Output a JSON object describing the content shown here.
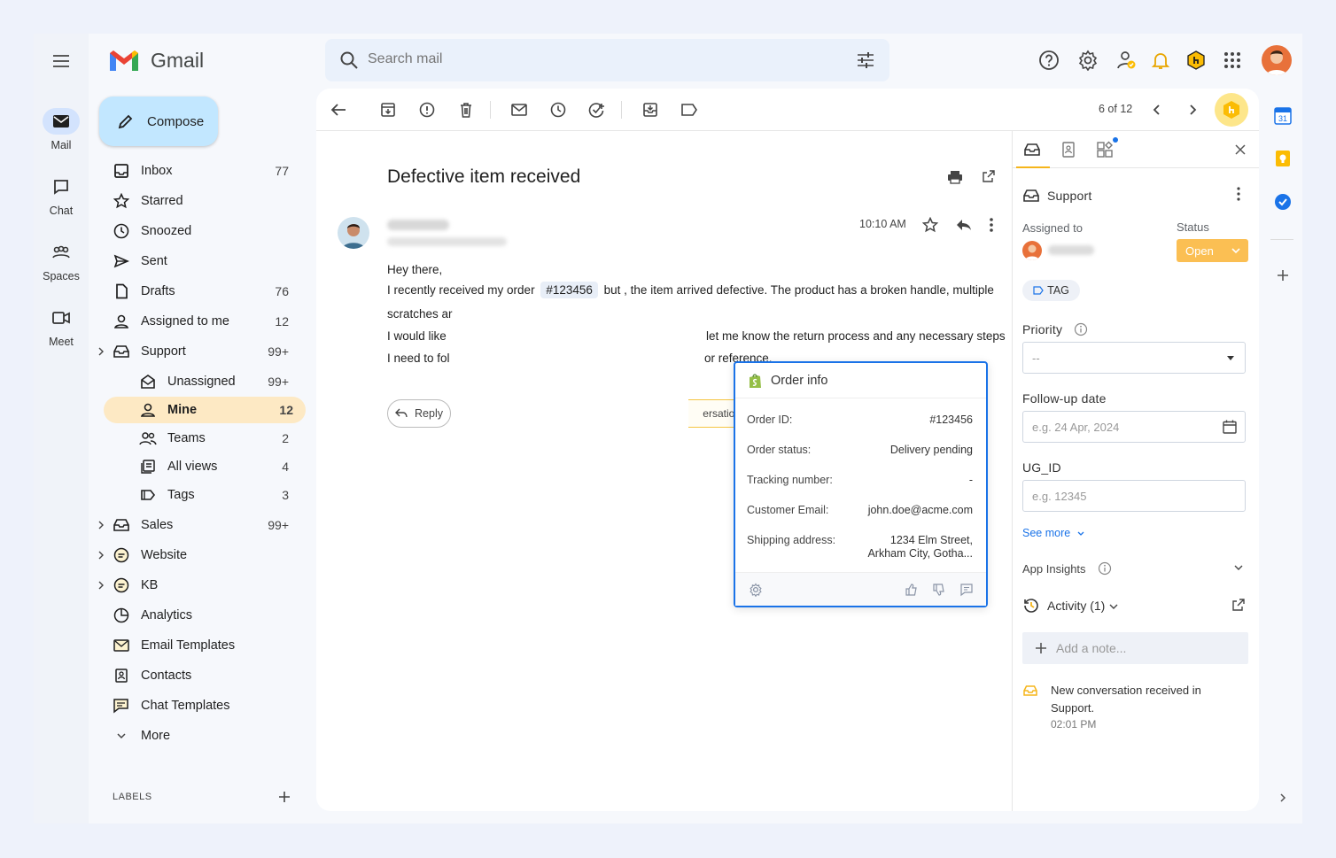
{
  "app": {
    "name": "Gmail"
  },
  "rail": [
    {
      "label": "Mail",
      "icon": "mail-icon",
      "active": true
    },
    {
      "label": "Chat",
      "icon": "chat-icon"
    },
    {
      "label": "Spaces",
      "icon": "spaces-icon"
    },
    {
      "label": "Meet",
      "icon": "meet-icon"
    }
  ],
  "compose": {
    "label": "Compose"
  },
  "nav": [
    {
      "label": "Inbox",
      "count": "77"
    },
    {
      "label": "Starred",
      "count": ""
    },
    {
      "label": "Snoozed",
      "count": ""
    },
    {
      "label": "Sent",
      "count": ""
    },
    {
      "label": "Drafts",
      "count": "76"
    },
    {
      "label": "Assigned to me",
      "count": "12"
    },
    {
      "label": "Support",
      "count": "99+"
    },
    {
      "label": "Unassigned",
      "count": "99+"
    },
    {
      "label": "Mine",
      "count": "12"
    },
    {
      "label": "Teams",
      "count": "2"
    },
    {
      "label": "All views",
      "count": "4"
    },
    {
      "label": "Tags",
      "count": "3"
    },
    {
      "label": "Sales",
      "count": "99+"
    },
    {
      "label": "Website",
      "count": ""
    },
    {
      "label": "KB",
      "count": ""
    },
    {
      "label": "Analytics",
      "count": ""
    },
    {
      "label": "Email Templates",
      "count": ""
    },
    {
      "label": "Contacts",
      "count": ""
    },
    {
      "label": "Chat Templates",
      "count": ""
    },
    {
      "label": "More",
      "count": ""
    }
  ],
  "labels": {
    "heading": "LABELS"
  },
  "search": {
    "placeholder": "Search mail"
  },
  "toolbar": {
    "pager": "6 of 12"
  },
  "email": {
    "subject": "Defective item received",
    "time": "10:10 AM",
    "lines": {
      "l1": "Hey there,",
      "l2a": "I recently received my order",
      "order_chip": "#123456",
      "l2b": "but , the item arrived defective. The product has a broken handle, multiple",
      "l3": "scratches ar",
      "l4a": "I would like",
      "l4b": "let me know the return process and any necessary steps",
      "l5a": "I need to fol",
      "l5b": "or reference."
    },
    "reply_label": "Reply",
    "conversation_label": "ersation"
  },
  "order_info": {
    "title": "Order info",
    "rows": [
      {
        "label": "Order ID:",
        "value": "#123456"
      },
      {
        "label": "Order status:",
        "value": "Delivery pending"
      },
      {
        "label": "Tracking number:",
        "value": "-"
      },
      {
        "label": "Customer Email:",
        "value": "john.doe@acme.com"
      },
      {
        "label": "Shipping address:",
        "value": "1234 Elm Street,",
        "value2": "Arkham City, Gotha..."
      }
    ]
  },
  "panel": {
    "inbox_name": "Support",
    "assigned_label": "Assigned to",
    "status_label": "Status",
    "status_value": "Open",
    "tag_label": "TAG",
    "priority_label": "Priority",
    "priority_value": "--",
    "followup_label": "Follow-up date",
    "followup_placeholder": "e.g. 24 Apr, 2024",
    "ugid_label": "UG_ID",
    "ugid_placeholder": "e.g. 12345",
    "see_more": "See more",
    "app_insights": "App Insights",
    "activity": "Activity (1)",
    "add_note": "Add a note...",
    "activity_text": "New conversation received in Support.",
    "activity_time": "02:01 PM"
  },
  "colors": {
    "accent": "#1a73e8",
    "brand_yellow": "#f5b51b",
    "status_open": "#fbbf53",
    "compose_bg": "#c2e7ff"
  }
}
